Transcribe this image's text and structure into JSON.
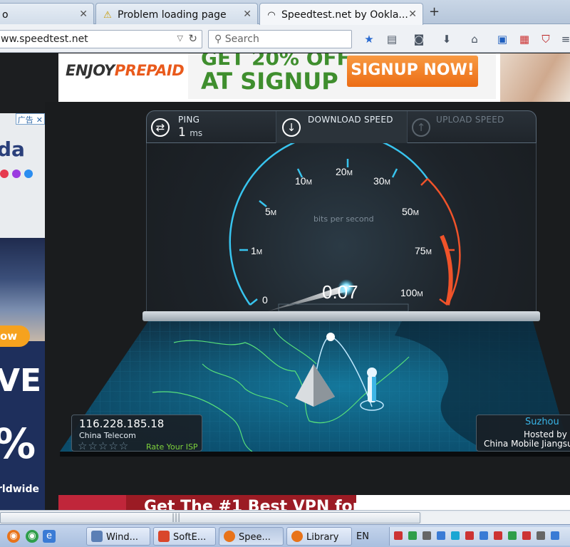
{
  "browser": {
    "tabs": [
      {
        "label": "o",
        "icon": "page-icon",
        "active": false
      },
      {
        "label": "Problem loading page",
        "icon": "warning-icon",
        "active": false
      },
      {
        "label": "Speedtest.net by Ookla...",
        "icon": "speedtest-icon",
        "active": true
      }
    ],
    "new_tab": "+",
    "url": "ww.speedtest.net",
    "search_placeholder": "Search"
  },
  "ads": {
    "top_brand_a": "ENJOY",
    "top_brand_b": "PREPAID",
    "top_line1": "GET 20% OFF",
    "top_line2": "AT SIGNUP",
    "top_button": "SIGNUP NOW!",
    "side_tag": "广告",
    "side_close": "✕",
    "side_brand": "da",
    "side_button": "ow",
    "side_big": "VE",
    "side_pct": "%",
    "side_small": "rldwide",
    "bottom_text": "Get The #1 Best VPN for"
  },
  "speedtest": {
    "ping_label": "PING",
    "ping_value": "1",
    "ping_unit": "ms",
    "download_label": "DOWNLOAD SPEED",
    "upload_label": "UPLOAD SPEED",
    "gauge_unit_text": "bits per second",
    "gauge_ticks": [
      "0",
      "1",
      "5",
      "10",
      "20",
      "30",
      "50",
      "75",
      "100"
    ],
    "gauge_tick_suffix": "M",
    "reading": "0.07",
    "client_ip": "116.228.185.18",
    "client_isp": "China Telecom",
    "rating_stars": "☆☆☆☆☆",
    "rate_isp": "Rate Your ISP",
    "server_city": "Suzhou",
    "server_hosted_by": "Hosted by",
    "server_name": "China Mobile Jiangsu Co"
  },
  "taskbar": {
    "buttons": [
      {
        "label": "Wind...",
        "color": "#5b7fb5"
      },
      {
        "label": "SoftE...",
        "color": "#d9462b"
      },
      {
        "label": "Spee...",
        "color": "#e8731a"
      },
      {
        "label": "Library",
        "color": "#e8731a"
      }
    ],
    "language": "EN"
  },
  "colors": {
    "gauge_blue": "#38c4ee",
    "gauge_red": "#f0532a",
    "map_glow": "#19a9d6",
    "accent_green": "#7ed23c"
  }
}
